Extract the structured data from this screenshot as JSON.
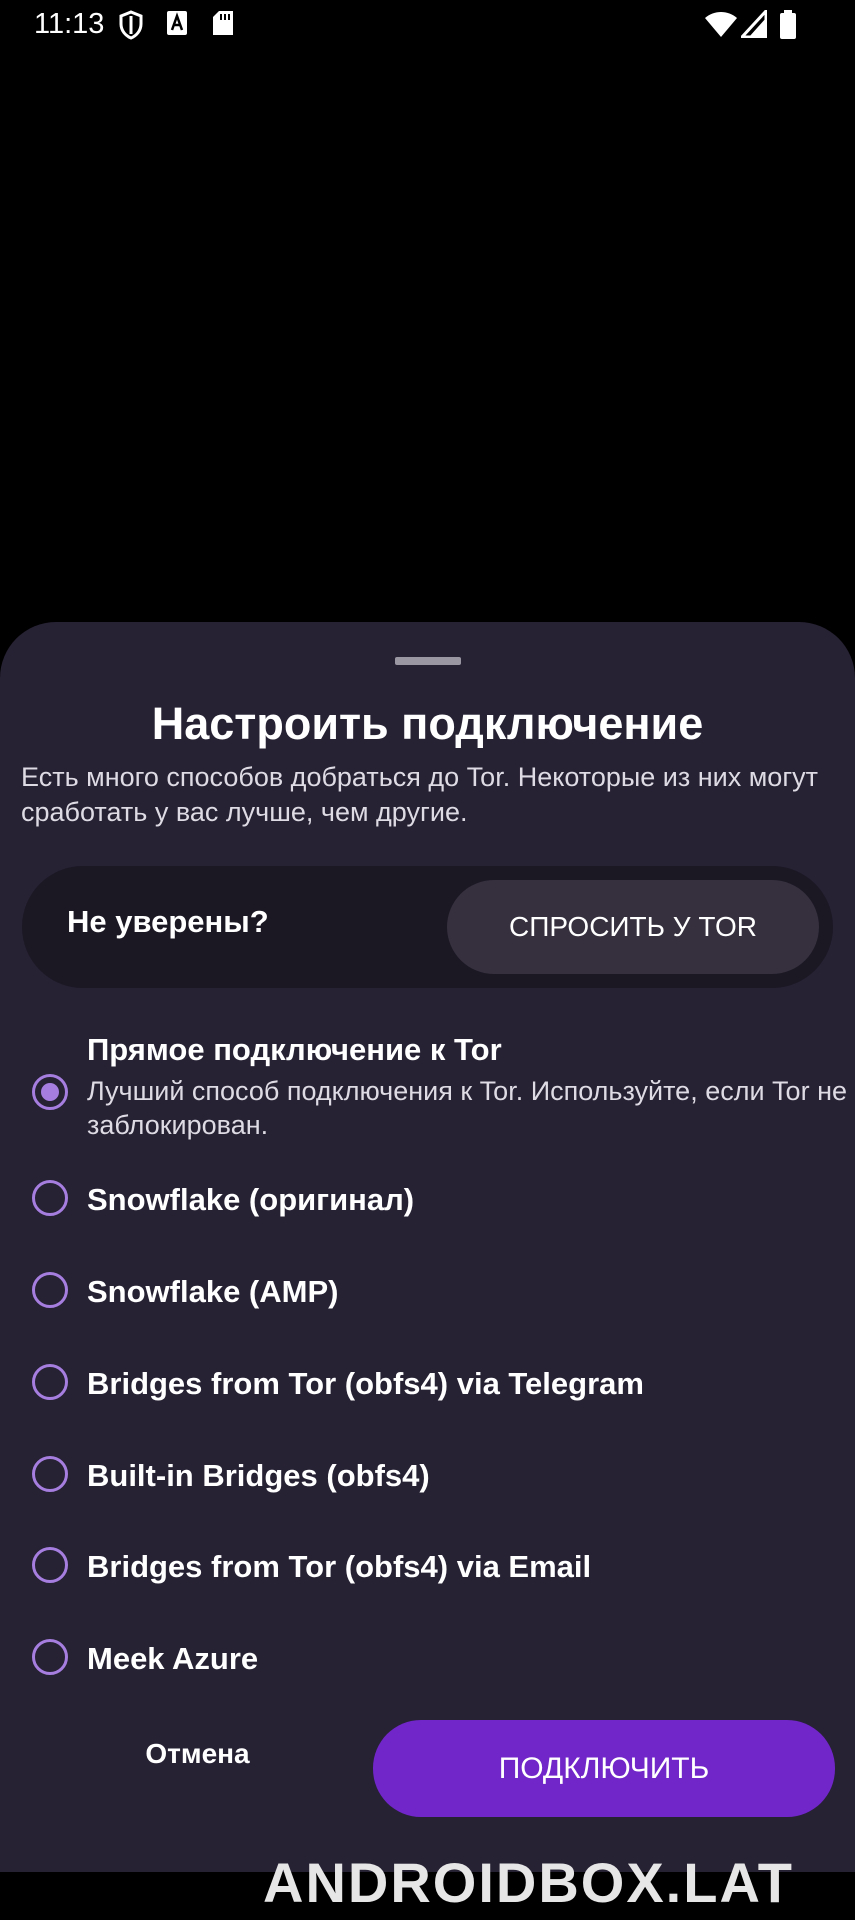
{
  "status_bar": {
    "time": "11:13",
    "icons": [
      "shield-icon",
      "font-a-icon",
      "sd-card-icon",
      "wifi-icon",
      "signal-icon",
      "battery-icon"
    ]
  },
  "sheet": {
    "title": "Настроить подключение",
    "subtitle": "Есть много способов добраться до Tor. Некоторые из них могут сработать у вас лучше, чем другие.",
    "ask_card": {
      "label": "Не уверены?",
      "button": "СПРОСИТЬ У TOR"
    },
    "options": [
      {
        "label": "Прямое подключение к Tor",
        "description": "Лучший способ подключения к Tor. Используйте, если Tor не заблокирован.",
        "selected": true
      },
      {
        "label": "Snowflake (оригинал)",
        "selected": false
      },
      {
        "label": "Snowflake (AMP)",
        "selected": false
      },
      {
        "label": "Bridges from Tor (obfs4) via Telegram",
        "selected": false
      },
      {
        "label": "Built-in Bridges (obfs4)",
        "selected": false
      },
      {
        "label": "Bridges from Tor (obfs4) via Email",
        "selected": false
      },
      {
        "label": "Meek Azure",
        "selected": false
      }
    ],
    "cancel": "Отмена",
    "connect": "ПОДКЛЮЧИТЬ"
  },
  "colors": {
    "sheet_bg": "#262133",
    "accent": "#7026c8",
    "radio": "#a57ee0"
  },
  "watermark": "ANDROIDBOX.LAT"
}
